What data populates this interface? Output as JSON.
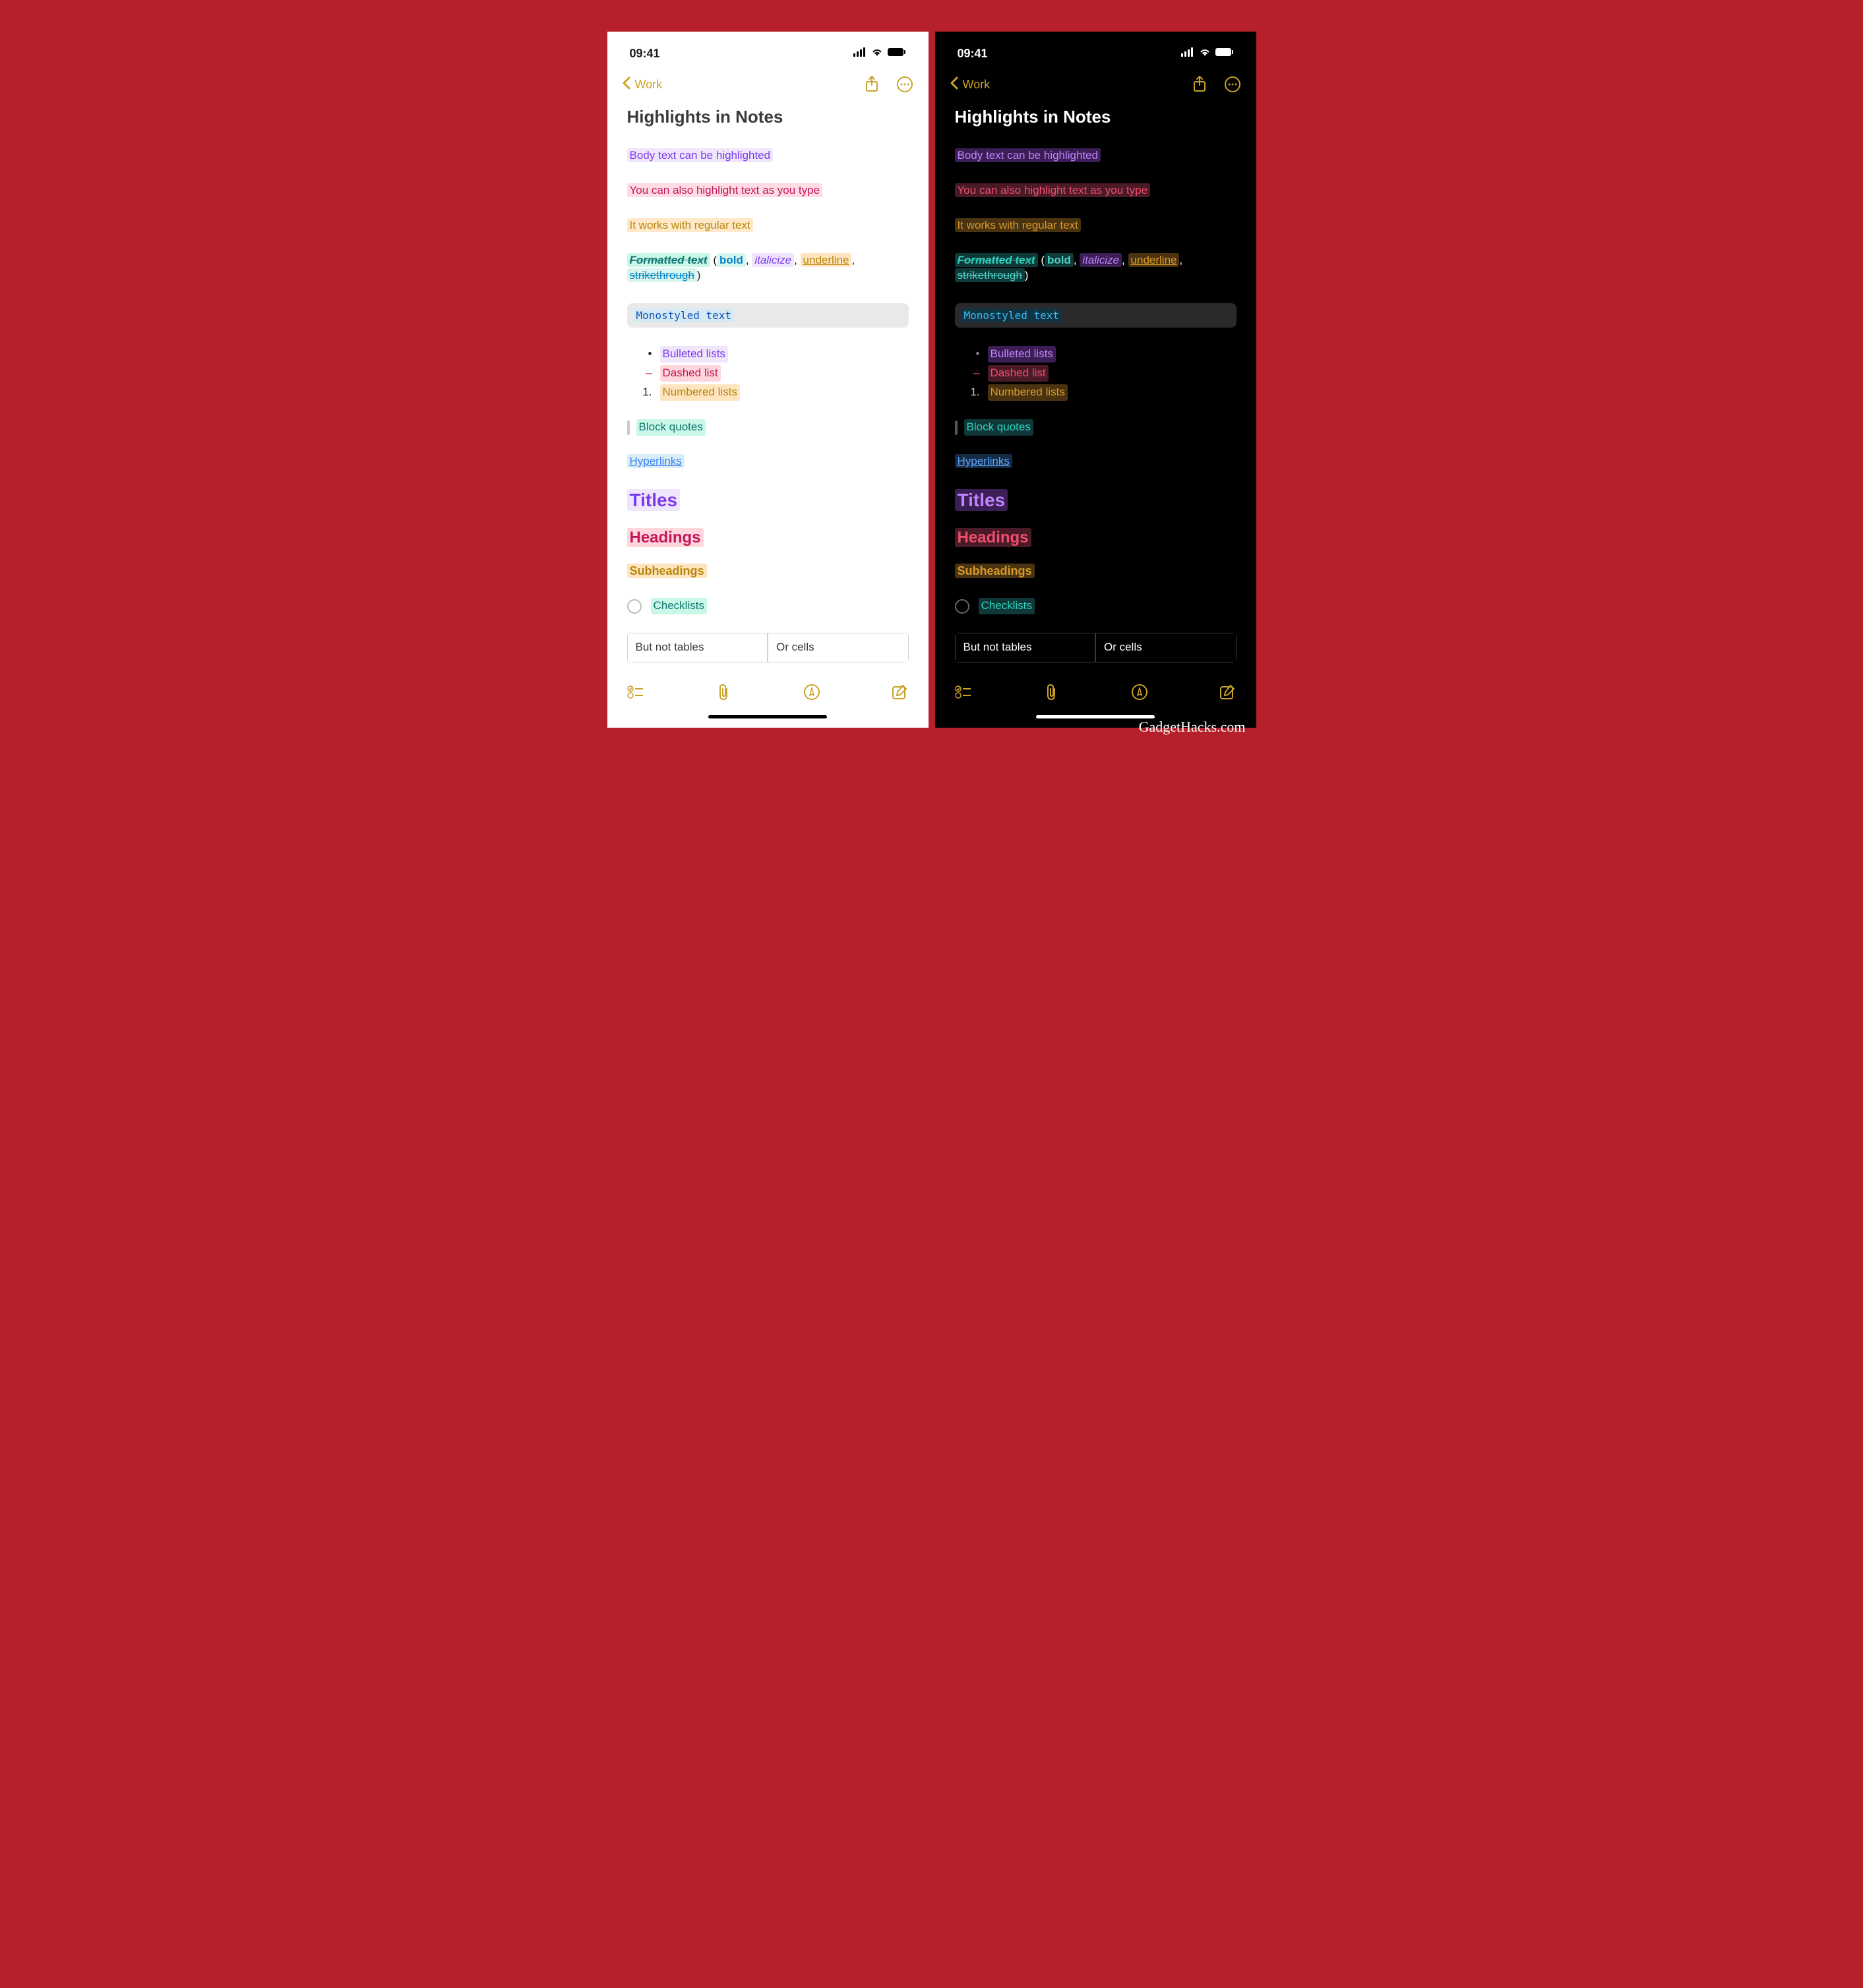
{
  "attribution": "GadgetHacks.com",
  "statusbar": {
    "time": "09:41"
  },
  "nav": {
    "back_label": "Work"
  },
  "note": {
    "title": "Highlights in Notes",
    "body_highlight": "Body text can be highlighted",
    "type_highlight": "You can also highlight text as you type",
    "regular_text": "It works with regular text",
    "formatted_prefix": "Formatted text",
    "bold": "bold",
    "italic": "italicize",
    "underline": "underline",
    "strike": "strikethrough",
    "mono": "Monostyled text",
    "bulleted": "Bulleted lists",
    "dashed": "Dashed list",
    "numbered": "Numbered lists",
    "blockquote": "Block quotes",
    "hyperlink": "Hyperlinks",
    "titles": "Titles",
    "headings": "Headings",
    "subheadings": "Subheadings",
    "checklists": "Checklists",
    "table_left": "But not tables",
    "table_right": "Or cells"
  }
}
